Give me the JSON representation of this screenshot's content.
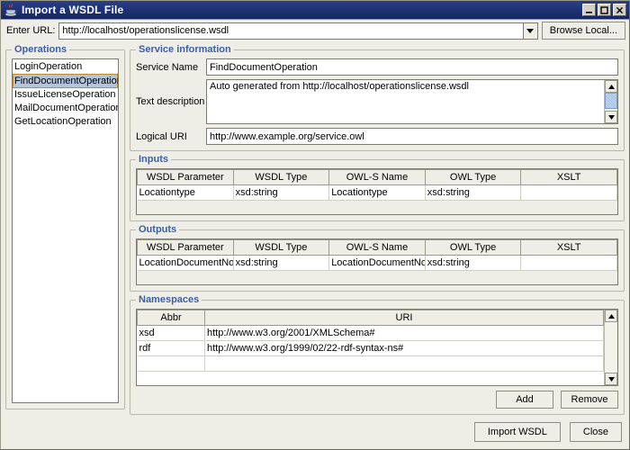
{
  "window": {
    "title": "Import a WSDL File",
    "icon": "java-coffee-cup-icon",
    "controls": {
      "minimize": "_",
      "maximize": "□",
      "close": "✕"
    }
  },
  "colors": {
    "titlebar": "#1f3377",
    "section_label": "#3a5fa8",
    "selection": "#b3c4dd",
    "focus_border": "#c08b2e",
    "background": "#eeeee6",
    "field_background": "#ffffff"
  },
  "url_bar": {
    "label": "Enter URL:",
    "value": "http://localhost/operationslicense.wsdl",
    "placeholder": "http://",
    "dropdown_icon": "chevron-down-icon",
    "browse_button": "Browse Local..."
  },
  "operations": {
    "title": "Operations",
    "items": [
      {
        "label": "LoginOperation",
        "selected": false
      },
      {
        "label": "FindDocumentOperation",
        "selected": true
      },
      {
        "label": "IssueLicenseOperation",
        "selected": false
      },
      {
        "label": "MailDocumentOperation",
        "selected": false
      },
      {
        "label": "GetLocationOperation",
        "selected": false
      }
    ]
  },
  "service_information": {
    "title": "Service information",
    "service_name": {
      "label": "Service Name",
      "value": "FindDocumentOperation"
    },
    "text_description": {
      "label": "Text description",
      "value": "Auto generated from http://localhost/operationslicense.wsdl"
    },
    "logical_uri": {
      "label": "Logical URI",
      "value": "http://www.example.org/service.owl"
    }
  },
  "inputs": {
    "title": "Inputs",
    "columns": [
      "WSDL Parameter",
      "WSDL Type",
      "OWL-S Name",
      "OWL Type",
      "XSLT"
    ],
    "rows": [
      [
        "Locationtype",
        "xsd:string",
        "Locationtype",
        "xsd:string",
        ""
      ]
    ]
  },
  "outputs": {
    "title": "Outputs",
    "columns": [
      "WSDL Parameter",
      "WSDL Type",
      "OWL-S Name",
      "OWL Type",
      "XSLT"
    ],
    "rows": [
      [
        "LocationDocumentNo",
        "xsd:string",
        "LocationDocumentNo",
        "xsd:string",
        ""
      ]
    ]
  },
  "namespaces": {
    "title": "Namespaces",
    "columns": [
      "Abbr",
      "URI"
    ],
    "rows": [
      [
        "xsd",
        "http://www.w3.org/2001/XMLSchema#"
      ],
      [
        "rdf",
        "http://www.w3.org/1999/02/22-rdf-syntax-ns#"
      ]
    ],
    "add_button": "Add",
    "remove_button": "Remove"
  },
  "footer": {
    "import_button": "Import WSDL",
    "close_button": "Close"
  }
}
